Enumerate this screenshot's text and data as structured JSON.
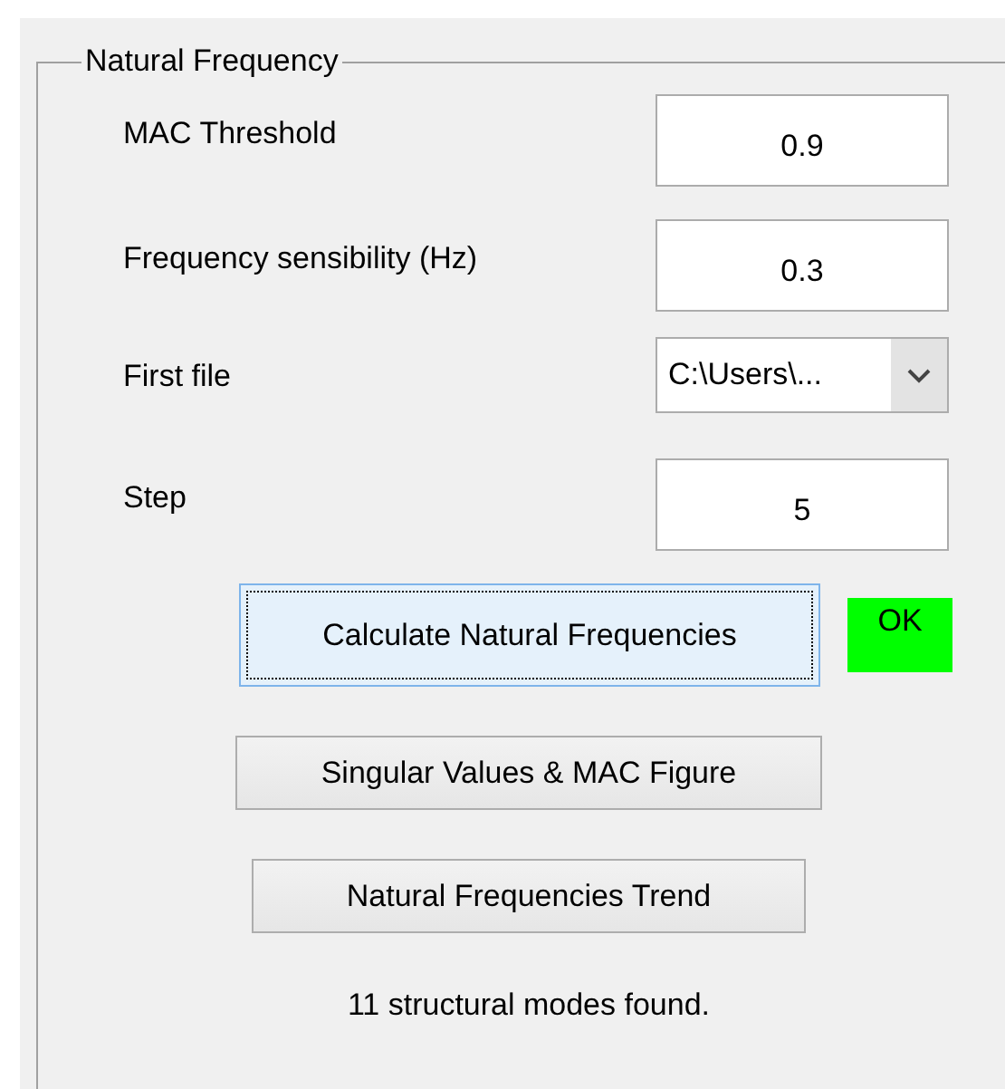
{
  "group": {
    "title": "Natural Frequency"
  },
  "fields": [
    {
      "kind": "text",
      "label": "MAC Threshold",
      "value": "0.9"
    },
    {
      "kind": "text",
      "label": "Frequency sensibility (Hz)",
      "value": "0.3"
    },
    {
      "kind": "dropdown",
      "label": "First file",
      "value": "C:\\Users\\..."
    },
    {
      "kind": "text",
      "label": "Step",
      "value": "5"
    }
  ],
  "buttons": [
    {
      "label": "Calculate Natural Frequencies",
      "focused": true
    },
    {
      "label": "Singular Values & MAC Figure",
      "focused": false
    },
    {
      "label": "Natural Frequencies Trend",
      "focused": false
    }
  ],
  "status_indicator": {
    "text": "OK",
    "color": "#00ff00"
  },
  "status_message": "11 structural modes found."
}
